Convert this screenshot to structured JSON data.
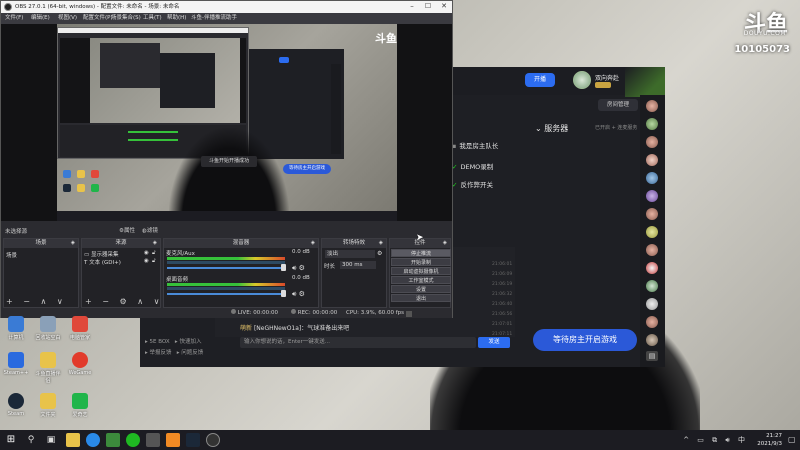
{
  "watermark": {
    "logo": "斗鱼",
    "site": "DOUYU.COM",
    "room": "10105073"
  },
  "obs": {
    "title": "OBS 27.0.1 (64-bit, windows) - 配置文件: 未命名 - 场景: 未命名",
    "menu": [
      "文件(F)",
      "编辑(E)",
      "视图(V)",
      "配置文件(P)",
      "场景集合(S)",
      "工具(T)",
      "帮助(H)",
      "斗鱼-伴播推流助手"
    ],
    "no_source": "未选择源",
    "properties": "属性",
    "filters": "滤镜",
    "panels": {
      "scenes": {
        "title": "场景",
        "items": [
          "场景"
        ]
      },
      "sources": {
        "title": "来源",
        "items": [
          "显示器采集",
          "文本 (GDI+)"
        ]
      },
      "mixer": {
        "title": "混音器",
        "ch1": "麦克风/Aux",
        "ch1_db": "0.0 dB",
        "ch2": "桌面音频",
        "ch2_db": "0.0 dB"
      },
      "transitions": {
        "title": "转场特效",
        "type": "淡出",
        "duration_label": "时长",
        "duration": "300 ms"
      },
      "controls": {
        "title": "控件",
        "buttons": [
          "停止推流",
          "开始录制",
          "启动虚拟摄像机",
          "工作室模式",
          "设置",
          "退出"
        ]
      }
    },
    "status": {
      "live": "LIVE: 00:00:00",
      "rec": "REC: 00:00:00",
      "cpu": "CPU: 3.9%, 60.00 fps"
    }
  },
  "nested": {
    "toast": "斗鱼开始开播成功",
    "wait": "等待房主开启游戏",
    "logo": "斗鱼"
  },
  "douyu": {
    "live_btn": "开播",
    "username": "双向奔赴",
    "room_btn": "房间管理",
    "server": "服务器",
    "server_right": "已开启 + 连麦服务",
    "options": [
      "我是房主队长",
      "DEMO录制",
      "反作弊开关"
    ],
    "msg_user": "萌新",
    "msg_text": "[NeGHNewO1a]：气球准备出来吧",
    "input_placeholder": "输入你想说的话，Enter一键发送...",
    "send": "发送",
    "wait": "等待房主开启游戏",
    "left_links": [
      "5E BOX",
      "快速加入",
      "举报反馈",
      "问题反馈"
    ],
    "times": [
      "21:06:01",
      "21:06:09",
      "21:06:19",
      "21:06:32",
      "21:06:40",
      "21:06:56",
      "21:07:01",
      "21:07:11"
    ]
  },
  "desktop_icons": [
    {
      "label": "计算机",
      "color": "#3a7bd5"
    },
    {
      "label": "回收站空白",
      "color": "#8aa0b8"
    },
    {
      "label": "电脑管家",
      "color": "#e0483a"
    },
    {
      "label": "Steam++",
      "color": "#2a6adf"
    },
    {
      "label": "斗鱼直播伴侣",
      "color": "#e8c34a"
    },
    {
      "label": "WeGame",
      "color": "#e23b2b"
    },
    {
      "label": "Steam",
      "color": "#1b2838"
    },
    {
      "label": "文件夹",
      "color": "#e8c34a"
    },
    {
      "label": "爱奇艺",
      "color": "#20b54a"
    }
  ],
  "taskbar": {
    "time": "21:27",
    "date": "2021/9/3"
  }
}
